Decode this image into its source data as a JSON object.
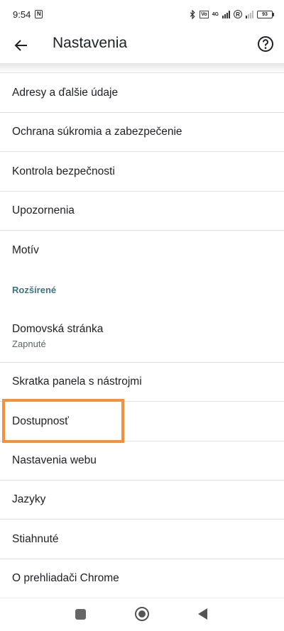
{
  "status_bar": {
    "time": "9:54",
    "notification_glyph": "N",
    "volte_label": "Vo",
    "network_label": "4G",
    "roaming_label": "R",
    "battery_level": "93"
  },
  "app_bar": {
    "title": "Nastavenia",
    "back_icon": "arrow-back-icon",
    "help_icon": "help-circle-icon"
  },
  "settings": {
    "items_top": [
      {
        "label": "Adresy a ďalšie údaje"
      },
      {
        "label": "Ochrana súkromia a zabezpečenie"
      },
      {
        "label": "Kontrola bezpečnosti"
      },
      {
        "label": "Upozornenia"
      },
      {
        "label": "Motív"
      }
    ],
    "advanced_header": "Rozšírené",
    "homepage": {
      "label": "Domovská stránka",
      "summary": "Zapnuté"
    },
    "items_advanced": [
      {
        "label": "Skratka panela s nástrojmi"
      },
      {
        "label": "Dostupnosť"
      },
      {
        "label": "Nastavenia webu"
      },
      {
        "label": "Jazyky"
      },
      {
        "label": "Stiahnuté"
      },
      {
        "label": "O prehliadači Chrome"
      }
    ]
  },
  "colors": {
    "section_header": "#3e7282",
    "highlight": "#f5913c"
  }
}
